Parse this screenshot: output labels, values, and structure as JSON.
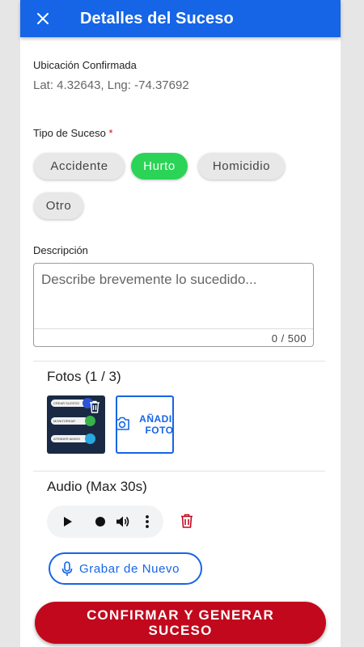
{
  "header": {
    "title": "Detalles del Suceso",
    "close_icon": "close-icon"
  },
  "location": {
    "label": "Ubicación Confirmada",
    "value": "Lat: 4.32643, Lng: -74.37692"
  },
  "incident_type": {
    "label": "Tipo de Suceso",
    "required_mark": "*",
    "options": [
      "Accidente",
      "Hurto",
      "Homicidio",
      "Otro"
    ],
    "selected": "Hurto",
    "selected_color": "#2bd456"
  },
  "description": {
    "label": "Descripción",
    "placeholder": "Describe brevemente lo sucedido...",
    "counter": "0 / 500"
  },
  "photos": {
    "title": "Fotos (1 / 3)",
    "thumbnail_pills": [
      "CREAR SUCESO",
      "MONITOREAR",
      "ATENDER AMIGO"
    ],
    "add_label": "AÑADIR FOTO",
    "icons": [
      "trash-icon",
      "camera-icon"
    ]
  },
  "audio": {
    "title": "Audio (Max 30s)",
    "player_icons": [
      "play-icon",
      "progress-dot",
      "volume-icon",
      "more-vertical-icon"
    ],
    "delete_icon": "trash-icon",
    "delete_color": "#c2081d",
    "record_again_label": "Grabar de Nuevo",
    "record_icon": "microphone-icon"
  },
  "confirm_button": {
    "label": "CONFIRMAR Y GENERAR SUCESO",
    "color": "#c2081d"
  },
  "colors": {
    "primary": "#1565e6",
    "danger": "#c2081d",
    "success": "#2bd456"
  }
}
